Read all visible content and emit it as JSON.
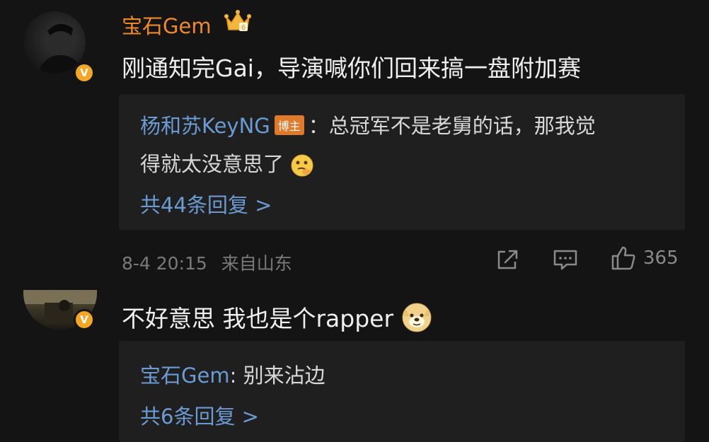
{
  "comments": [
    {
      "username": "宝石Gem",
      "text": "刚通知完Gai，导演喊你们回来搞一盘附加赛",
      "reply": {
        "author": "杨和苏KeyNG",
        "tag": "博主",
        "text_line1": "：总冠军不是老舅的话，那我觉",
        "text_line2": "得就太没意思了"
      },
      "more_replies": "共44条回复 >",
      "timestamp": "8-4 20:15",
      "location": "来自山东",
      "like_count": "365"
    },
    {
      "text": "不好意思 我也是个rapper",
      "reply": {
        "author": "宝石Gem",
        "text": ": 别来沾边"
      },
      "more_replies": "共6条回复 >"
    }
  ],
  "colors": {
    "background": "#141414",
    "username": "#f08a24",
    "link": "#6b9bd3",
    "badge": "#f5a623",
    "reply_box": "#1f1f1f"
  },
  "icons": {
    "verified_badge": "V",
    "crown": "crown-icon",
    "share": "share-icon",
    "comment": "comment-icon",
    "like": "thumbs-up-icon",
    "emoji1": "thinking-emoji",
    "emoji2": "doge-emoji"
  }
}
